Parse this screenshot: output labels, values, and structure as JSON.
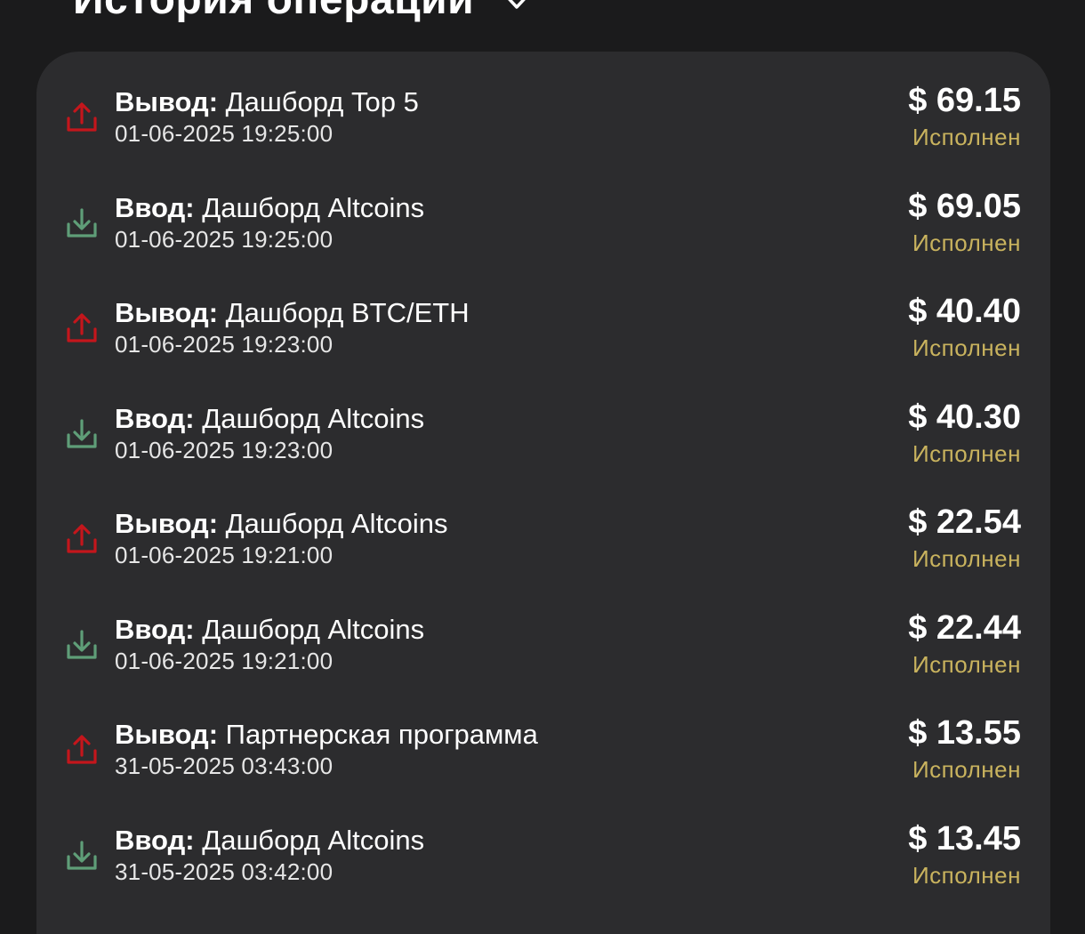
{
  "header": {
    "title": "История операций",
    "chevron_icon": "chevron-down-icon"
  },
  "colors": {
    "background": "#1b1b1c",
    "card": "#2c2c2e",
    "withdraw_icon": "#c4161c",
    "deposit_icon": "#5f9e78",
    "status": "#c9b35e"
  },
  "operations": [
    {
      "type": "Вывод:",
      "name": "Дашборд Top 5",
      "date": "01-06-2025 19:25:00",
      "amount": "$ 69.15",
      "status": "Исполнен",
      "icon": "upload-icon"
    },
    {
      "type": "Ввод:",
      "name": "Дашборд Altcoins",
      "date": "01-06-2025 19:25:00",
      "amount": "$ 69.05",
      "status": "Исполнен",
      "icon": "download-icon"
    },
    {
      "type": "Вывод:",
      "name": "Дашборд BTC/ETH",
      "date": "01-06-2025 19:23:00",
      "amount": "$ 40.40",
      "status": "Исполнен",
      "icon": "upload-icon"
    },
    {
      "type": "Ввод:",
      "name": "Дашборд Altcoins",
      "date": "01-06-2025 19:23:00",
      "amount": "$ 40.30",
      "status": "Исполнен",
      "icon": "download-icon"
    },
    {
      "type": "Вывод:",
      "name": "Дашборд Altcoins",
      "date": "01-06-2025 19:21:00",
      "amount": "$ 22.54",
      "status": "Исполнен",
      "icon": "upload-icon"
    },
    {
      "type": "Ввод:",
      "name": "Дашборд Altcoins",
      "date": "01-06-2025 19:21:00",
      "amount": "$ 22.44",
      "status": "Исполнен",
      "icon": "download-icon"
    },
    {
      "type": "Вывод:",
      "name": "Партнерская программа",
      "date": "31-05-2025 03:43:00",
      "amount": "$ 13.55",
      "status": "Исполнен",
      "icon": "upload-icon"
    },
    {
      "type": "Ввод:",
      "name": "Дашборд Altcoins",
      "date": "31-05-2025 03:42:00",
      "amount": "$ 13.45",
      "status": "Исполнен",
      "icon": "download-icon"
    }
  ]
}
